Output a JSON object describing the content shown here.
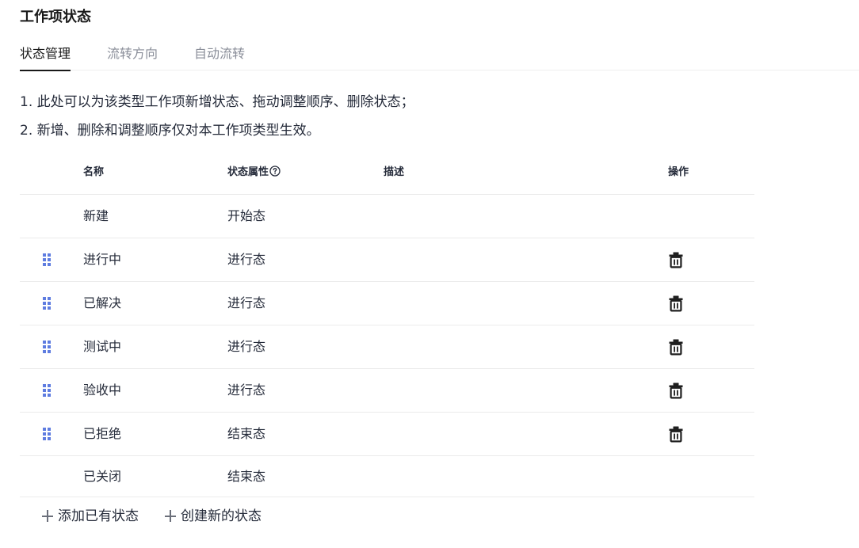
{
  "header": {
    "title": "工作项状态"
  },
  "tabs": [
    {
      "label": "状态管理",
      "active": true
    },
    {
      "label": "流转方向",
      "active": false
    },
    {
      "label": "自动流转",
      "active": false
    }
  ],
  "tips": [
    "1. 此处可以为该类型工作项新增状态、拖动调整顺序、删除状态；",
    "2. 新增、删除和调整顺序仅对本工作项类型生效。"
  ],
  "table": {
    "columns": {
      "name": "名称",
      "attribute": "状态属性",
      "description": "描述",
      "operation": "操作"
    },
    "rows": [
      {
        "name": "新建",
        "attribute": "开始态",
        "description": "",
        "draggable": false,
        "deletable": false
      },
      {
        "name": "进行中",
        "attribute": "进行态",
        "description": "",
        "draggable": true,
        "deletable": true
      },
      {
        "name": "已解决",
        "attribute": "进行态",
        "description": "",
        "draggable": true,
        "deletable": true
      },
      {
        "name": "测试中",
        "attribute": "进行态",
        "description": "",
        "draggable": true,
        "deletable": true
      },
      {
        "name": "验收中",
        "attribute": "进行态",
        "description": "",
        "draggable": true,
        "deletable": true
      },
      {
        "name": "已拒绝",
        "attribute": "结束态",
        "description": "",
        "draggable": true,
        "deletable": true
      },
      {
        "name": "已关闭",
        "attribute": "结束态",
        "description": "",
        "draggable": false,
        "deletable": false
      }
    ]
  },
  "footer": {
    "add_existing_label": "添加已有状态",
    "create_new_label": "创建新的状态"
  },
  "colors": {
    "drag_handle": "#5e7ce0",
    "text": "#252b3a",
    "tab_inactive": "#8a8e99",
    "divider": "#ebebeb"
  }
}
